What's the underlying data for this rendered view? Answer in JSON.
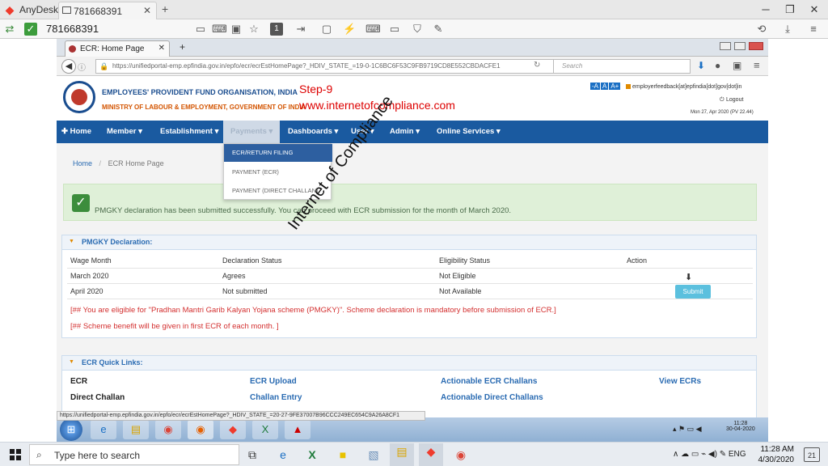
{
  "anydesk": {
    "app_name": "AnyDesk",
    "tab_label": "781668391",
    "address": "781668391"
  },
  "browser": {
    "tab_title": "ECR: Home Page",
    "url": "https://unifiedportal-emp.epfindia.gov.in/epfo/ecr/ecrEstHomePage?_HDIV_STATE_=19-0-1C6BC6F53C9FB9719CD8E552CBDACFE1",
    "search_placeholder": "Search"
  },
  "header": {
    "org_name": "EMPLOYEES' PROVIDENT FUND ORGANISATION, INDIA",
    "ministry": "MINISTRY OF LABOUR & EMPLOYMENT, GOVERNMENT OF INDIA",
    "step_label": "Step-9",
    "site_watermark": "www.internetofcompliance.com",
    "font_sizes": [
      "-A",
      "A",
      "A+"
    ],
    "email": "employerfeedback[at]epfindia[dot]gov[dot]in",
    "logout": "Logout",
    "datetime": "Mon 27, Apr 2020 (PV 22.44)"
  },
  "menu": {
    "home": "Home",
    "member": "Member ▾",
    "establishment": "Establishment ▾",
    "payments": "Payments ▾",
    "dashboards": "Dashboards ▾",
    "user": "User ▾",
    "admin": "Admin ▾",
    "online_services": "Online Services ▾"
  },
  "dropdown": {
    "items": [
      "ECR/RETURN FILING",
      "PAYMENT (ECR)",
      "PAYMENT (DIRECT CHALLAN)"
    ]
  },
  "breadcrumb": {
    "home": "Home",
    "sep": "/",
    "current": "ECR Home Page"
  },
  "alert": {
    "text": "PMGKY declaration has been submitted successfully. You can proceed with ECR submission for the month of March 2020."
  },
  "pmgky": {
    "title": "PMGKY Declaration:",
    "headers": [
      "Wage Month",
      "Declaration Status",
      "Eligibility Status",
      "Action"
    ],
    "rows": [
      {
        "month": "March 2020",
        "declaration": "Agrees",
        "eligibility": "Not Eligible",
        "action": "download-icon"
      },
      {
        "month": "April 2020",
        "declaration": "Not submitted",
        "eligibility": "Not Available",
        "action": "Submit"
      }
    ],
    "note1": "[## You are eligible for \"Pradhan Mantri Garib Kalyan Yojana scheme (PMGKY)\". Scheme declaration is mandatory before submission of ECR.]",
    "note2": "[## Scheme benefit will be given in first ECR of each month. ]"
  },
  "quicklinks": {
    "title": "ECR Quick Links:",
    "ecr": "ECR",
    "ecr_upload": "ECR Upload",
    "actionable_ecr": "Actionable ECR Challans",
    "view_ecrs": "View ECRs",
    "direct_challan": "Direct Challan",
    "challan_entry": "Challan Entry",
    "actionable_direct": "Actionable Direct Challans"
  },
  "status_url": "https://unifiedportal-emp.epfindia.gov.in/epfo/ecr/ecrEstHomePage?_HDIV_STATE_=20-27-9FE37007B96CCC249EC654C9A26A8CF1",
  "watermark": "Internet of Compliance",
  "remote_taskbar": {
    "time": "11:28",
    "date": "30-04-2020"
  },
  "local_taskbar": {
    "search_placeholder": "Type here to search",
    "time": "11:28 AM",
    "date": "4/30/2020",
    "notifications": "21"
  },
  "colors": {
    "menu_bg": "#1a5aa0",
    "alert_bg": "#dff0d8",
    "link_blue": "#2a6bb2",
    "note_red": "#d32f2f",
    "step_red": "#dd0000"
  }
}
